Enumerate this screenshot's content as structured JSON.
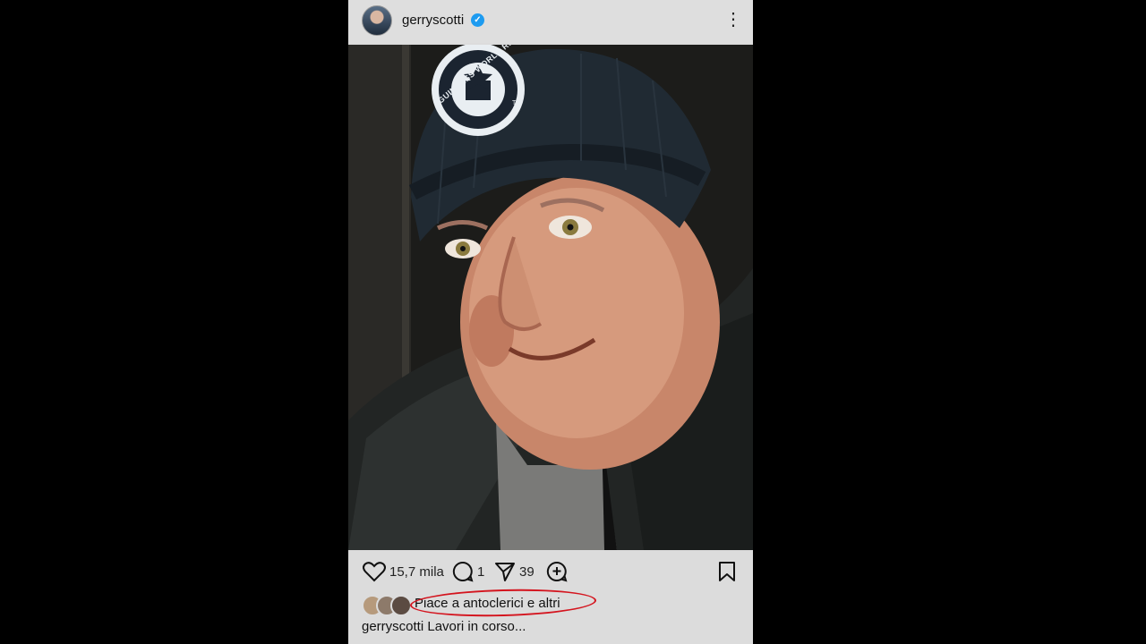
{
  "post": {
    "username": "gerryscotti",
    "verified": true,
    "more_icon": "more-vertical-icon",
    "photo": {
      "hat_logo_text": "GUINNESS WORLD RECORDS",
      "hat_logo_trademark": "TM"
    },
    "actions": {
      "like_count": "15,7 mila",
      "comment_count": "1",
      "share_count": "39",
      "icons": [
        "heart-icon",
        "comment-icon",
        "send-icon",
        "remix-icon",
        "bookmark-icon"
      ]
    },
    "likes_text": "Piace a antoclerici e altri",
    "caption": {
      "username": "gerryscotti",
      "text": "Lavori in corso..."
    },
    "colors": {
      "verified": "#1d9bf0",
      "highlight_ellipse": "#d4141e"
    }
  }
}
